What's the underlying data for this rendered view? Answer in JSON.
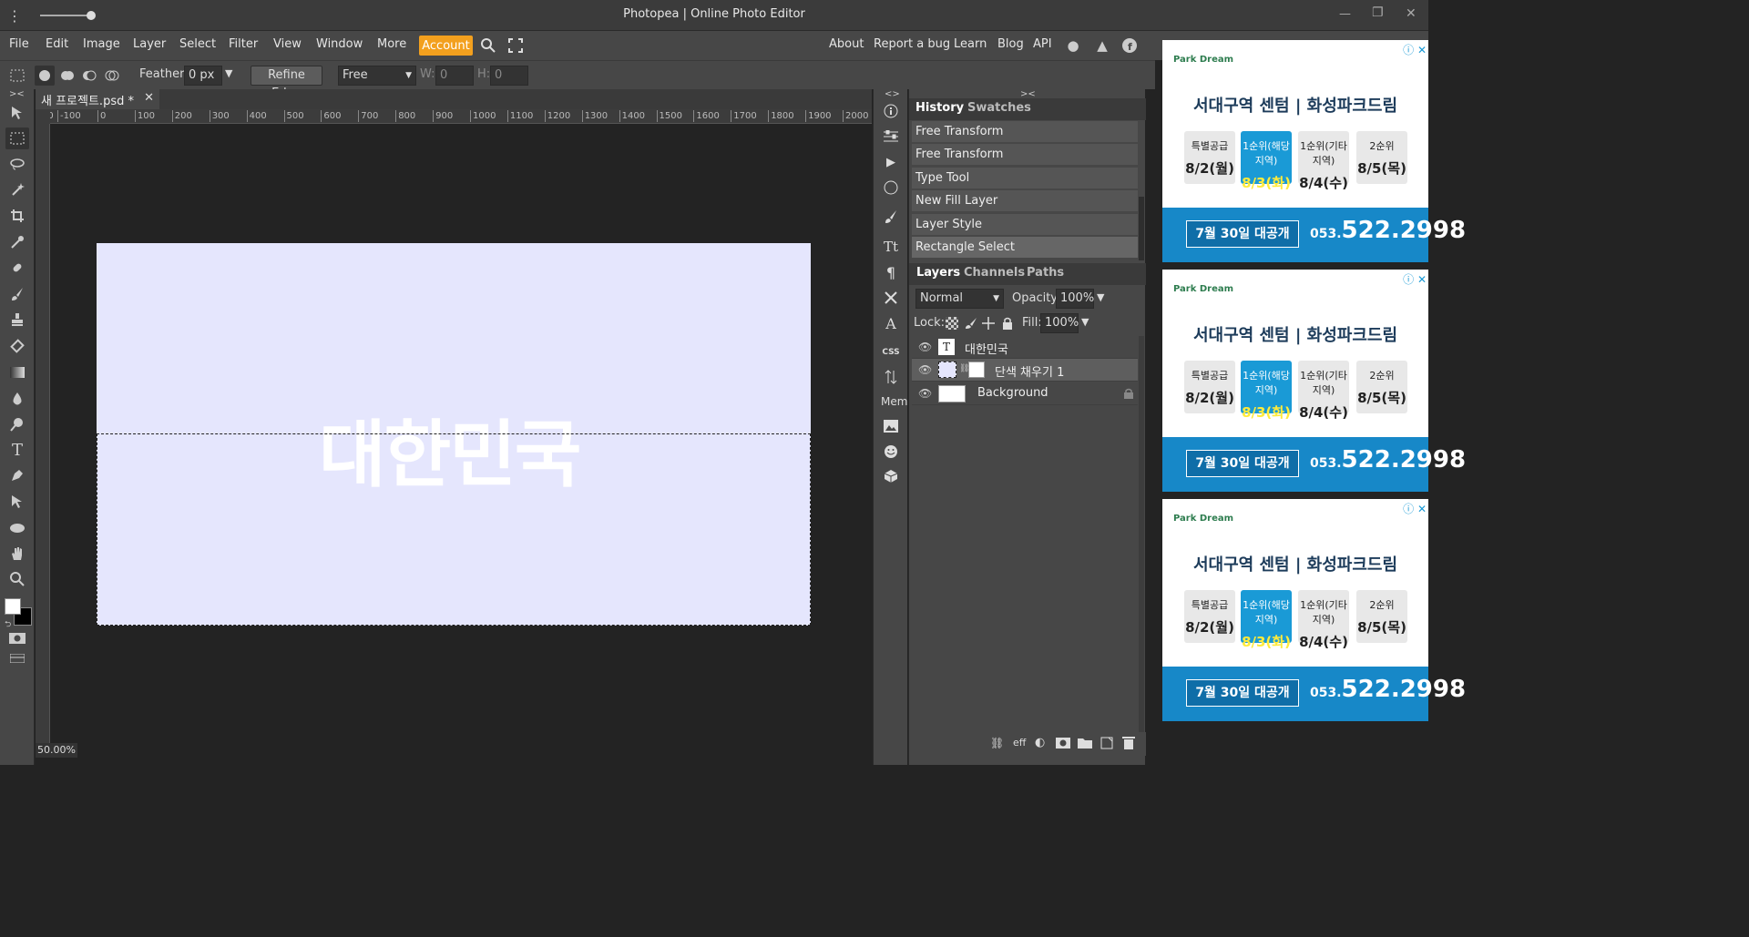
{
  "window": {
    "title": "Photopea | Online Photo Editor",
    "minimize": "—",
    "restore": "❐",
    "close": "✕"
  },
  "menu": {
    "items": [
      "File",
      "Edit",
      "Image",
      "Layer",
      "Select",
      "Filter",
      "View",
      "Window",
      "More"
    ],
    "account": "Account",
    "right_links": [
      "About",
      "Report a bug",
      "Learn",
      "Blog",
      "API"
    ]
  },
  "options": {
    "feather_label": "Feather:",
    "feather_value": "0 px",
    "refine_edge": "Refine Edge",
    "style_value": "Free",
    "w_label": "W:",
    "w_value": "0",
    "h_label": "H:",
    "h_value": "0"
  },
  "document": {
    "tab_name": "새 프로젝트.psd *",
    "canvas_text": "대한민국",
    "zoom": "50.00%",
    "canvas_color": "#e5e6fd",
    "ruler_ticks": [
      "00",
      "-100",
      "0",
      "100",
      "200",
      "300",
      "400",
      "500",
      "600",
      "700",
      "800",
      "900",
      "1000",
      "1100",
      "1200",
      "1300",
      "1400",
      "1500",
      "1600",
      "1700",
      "1800",
      "1900",
      "2000"
    ]
  },
  "side_strip": {
    "mem_label": "Mem",
    "css_label": "CSS"
  },
  "history": {
    "tabs": [
      "History",
      "Swatches"
    ],
    "items": [
      "Free Transform",
      "Free Transform",
      "Type Tool",
      "New Fill Layer",
      "Layer Style",
      "Rectangle Select"
    ]
  },
  "layers": {
    "tabs": [
      "Layers",
      "Channels",
      "Paths"
    ],
    "blend_mode": "Normal",
    "opacity_label": "Opacity:",
    "opacity_value": "100%",
    "lock_label": "Lock:",
    "fill_label": "Fill:",
    "fill_value": "100%",
    "items": [
      {
        "name": "대한민국"
      },
      {
        "name": "단색 채우기 1"
      },
      {
        "name": "Background"
      }
    ],
    "footer_eff": "eff"
  },
  "ads": {
    "logo": "Park Dream",
    "headline": "서대구역 센텀 | 화성파크드림",
    "dates": [
      {
        "label": "특별공급",
        "date": "8/2(월)"
      },
      {
        "label": "1순위(해당지역)",
        "date": "8/3(화)"
      },
      {
        "label": "1순위(기타지역)",
        "date": "8/4(수)"
      },
      {
        "label": "2순위",
        "date": "8/5(목)"
      }
    ],
    "open_text": "7월 30일 대공개",
    "phone_prefix": "053.",
    "phone": "522.2998"
  },
  "colors": {
    "accent": "#f3a01e",
    "panel": "#474747",
    "ad_blue": "#1788c8"
  }
}
